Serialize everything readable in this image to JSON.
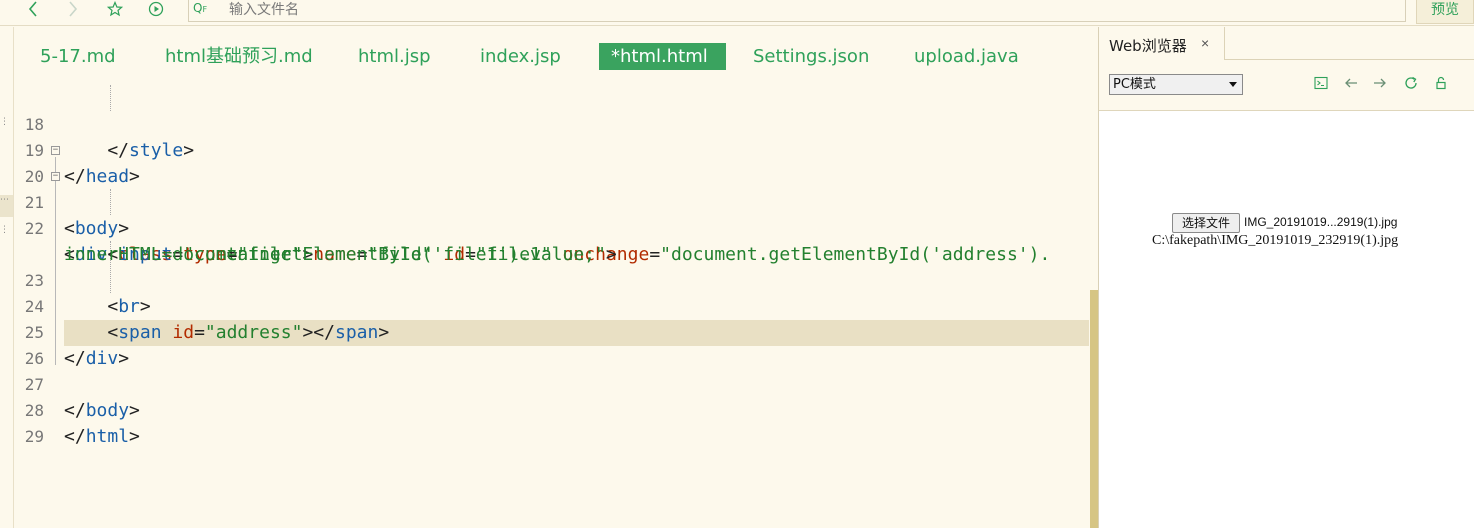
{
  "toolbar": {
    "search_placeholder": "输入文件名",
    "search_prefix": "Q",
    "search_flag": "F",
    "preview_label": "预览",
    "icons": [
      "chevron-left-icon",
      "chevron-right-icon",
      "star-icon",
      "play-circle-icon"
    ]
  },
  "tabs": [
    {
      "label": "5-17.md",
      "active": false
    },
    {
      "label": "html基础预习.md",
      "active": false
    },
    {
      "label": "html.jsp",
      "active": false
    },
    {
      "label": "index.jsp",
      "active": false
    },
    {
      "label": "*html.html",
      "active": true
    },
    {
      "label": "Settings.json",
      "active": false
    },
    {
      "label": "upload.java",
      "active": false
    }
  ],
  "code": {
    "current_line": "26",
    "lines": [
      {
        "num": "18",
        "text": "    </style>"
      },
      {
        "num": "19",
        "text": "</head>"
      },
      {
        "num": "20",
        "text": "<body>"
      },
      {
        "num": "21",
        "text": "<div class=\"container\">"
      },
      {
        "num": "22",
        "text": "    <input type=\"file\" name=\"file\" id=\"file1\" onchange=\"document.getElementById('address')."
      },
      {
        "num": "",
        "text": "innerHTML=document.getElementById('file1').value;\">"
      },
      {
        "num": "23",
        "text": "    <br>"
      },
      {
        "num": "24",
        "text": "    <span id=\"address\"></span>"
      },
      {
        "num": "25",
        "text": "</div>"
      },
      {
        "num": "26",
        "text": ""
      },
      {
        "num": "27",
        "text": "</body>"
      },
      {
        "num": "28",
        "text": "</html>"
      },
      {
        "num": "29",
        "text": ""
      }
    ]
  },
  "browser": {
    "tab_label": "Web浏览器",
    "close_glyph": "×",
    "mode": "PC模式",
    "icons": [
      "console-icon",
      "back-arrow-icon",
      "forward-arrow-icon",
      "refresh-icon",
      "lock-icon"
    ],
    "file_button_label": "选择文件",
    "file_name": "IMG_20191019...2919(1).jpg",
    "file_path": "C:\\fakepath\\IMG_20191019_232919(1).jpg"
  },
  "colors": {
    "accent": "#2fa15a",
    "active_tab_bg": "#3aa35f",
    "editor_bg": "#fdf9ec",
    "current_line_bg": "#e9e0c4",
    "tag": "#1a5fa8",
    "attribute": "#b22b00",
    "string": "#23802f"
  }
}
